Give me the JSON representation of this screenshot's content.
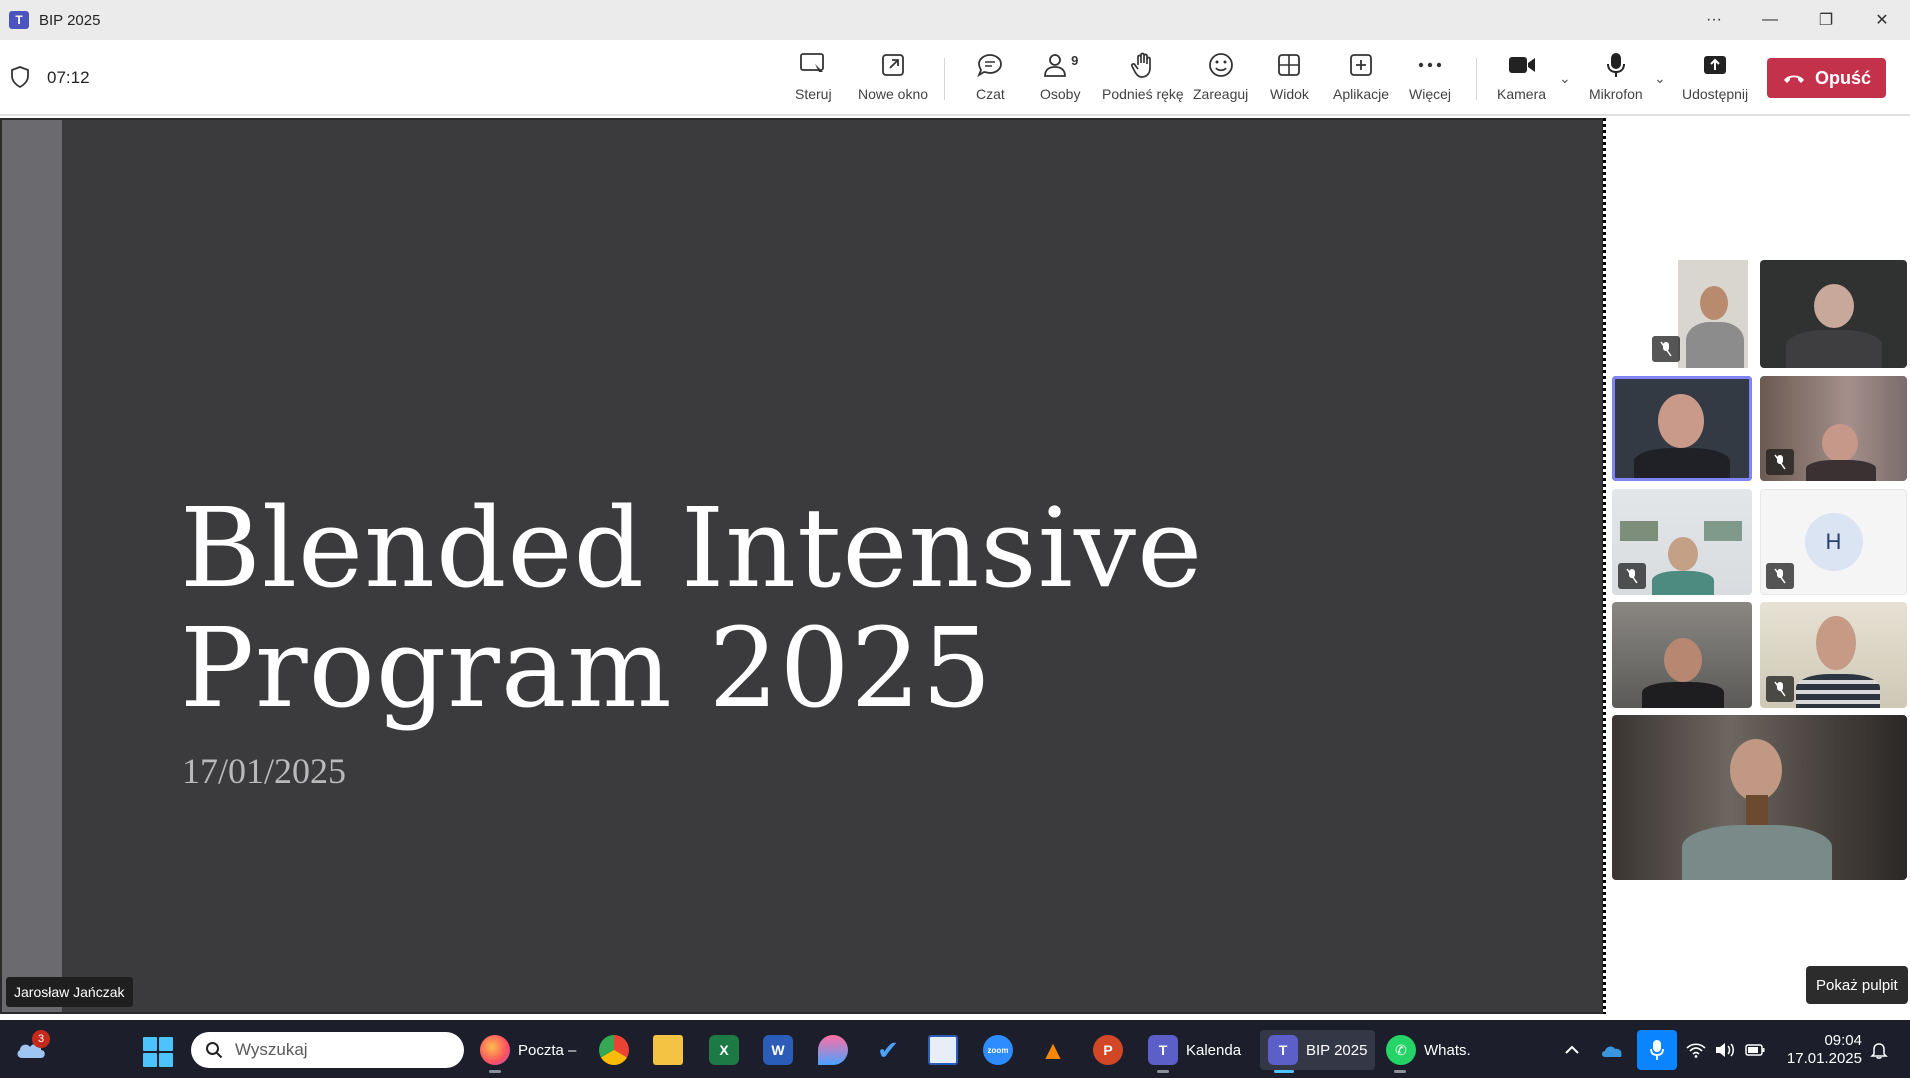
{
  "window": {
    "title": "BIP 2025",
    "more": "···",
    "minimize": "—",
    "maximize": "❐",
    "close": "✕"
  },
  "meeting": {
    "elapsed": "07:12"
  },
  "toolbar": {
    "control": "Steruj",
    "new_window": "Nowe okno",
    "chat": "Czat",
    "people": "Osoby",
    "people_count": "9",
    "raise_hand": "Podnieś rękę",
    "react": "Zareaguj",
    "view": "Widok",
    "apps": "Aplikacje",
    "more": "Więcej",
    "camera": "Kamera",
    "mic": "Mikrofon",
    "share": "Udostępnij",
    "leave": "Opuść"
  },
  "slide": {
    "title_line1": "Blended Intensive",
    "title_line2": "Program 2025",
    "date": "17/01/2025"
  },
  "presenter_name": "Jarosław Jańczak",
  "gallery": {
    "avatar_initial": "H"
  },
  "show_desktop": "Pokaż pulpit",
  "taskbar": {
    "weather_badge": "3",
    "search_placeholder": "Wyszukaj",
    "apps": [
      {
        "label": "Poczta –"
      },
      {
        "label": "Kalenda"
      },
      {
        "label": "BIP 2025"
      },
      {
        "label": "Whats."
      }
    ],
    "clock_time": "09:04",
    "clock_date": "17.01.2025"
  },
  "colors": {
    "accent": "#4b53bc",
    "leave": "#c4314b",
    "slide_bg": "#3b3b3d",
    "taskbar": "#1c1f2b"
  }
}
